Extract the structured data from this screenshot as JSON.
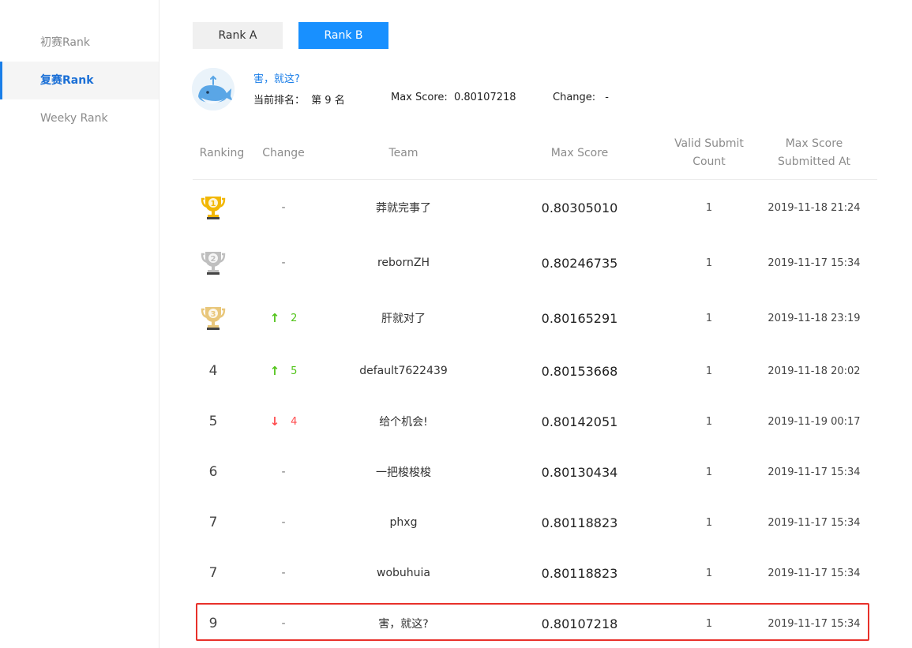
{
  "sidebar": {
    "items": [
      {
        "label": "初赛Rank",
        "active": false
      },
      {
        "label": "复赛Rank",
        "active": true
      },
      {
        "label": "Weeky Rank",
        "active": false
      }
    ]
  },
  "tabs": [
    {
      "label": "Rank A",
      "active": false
    },
    {
      "label": "Rank B",
      "active": true
    }
  ],
  "user": {
    "name": "害，就这?",
    "rank_label": "当前排名：",
    "rank_value": "第 9 名",
    "max_score_label": "Max Score:",
    "max_score_value": "0.80107218",
    "change_label": "Change:",
    "change_value": "-"
  },
  "table": {
    "headers": {
      "ranking": "Ranking",
      "change": "Change",
      "team": "Team",
      "max_score": "Max Score",
      "valid_submit_count": "Valid Submit Count",
      "submitted_at": "Max Score Submitted At"
    },
    "rows": [
      {
        "rank": "1",
        "trophy": "gold",
        "change": "-",
        "dir": "none",
        "team": "莽就完事了",
        "score": "0.80305010",
        "count": "1",
        "time": "2019-11-18 21:24"
      },
      {
        "rank": "2",
        "trophy": "silver",
        "change": "-",
        "dir": "none",
        "team": "rebornZH",
        "score": "0.80246735",
        "count": "1",
        "time": "2019-11-17 15:34"
      },
      {
        "rank": "3",
        "trophy": "bronze",
        "change": "2",
        "dir": "up",
        "team": "肝就对了",
        "score": "0.80165291",
        "count": "1",
        "time": "2019-11-18 23:19"
      },
      {
        "rank": "4",
        "trophy": "",
        "change": "5",
        "dir": "up",
        "team": "default7622439",
        "score": "0.80153668",
        "count": "1",
        "time": "2019-11-18 20:02"
      },
      {
        "rank": "5",
        "trophy": "",
        "change": "4",
        "dir": "down",
        "team": "给个机会!",
        "score": "0.80142051",
        "count": "1",
        "time": "2019-11-19 00:17"
      },
      {
        "rank": "6",
        "trophy": "",
        "change": "-",
        "dir": "none",
        "team": "一把梭梭梭",
        "score": "0.80130434",
        "count": "1",
        "time": "2019-11-17 15:34"
      },
      {
        "rank": "7",
        "trophy": "",
        "change": "-",
        "dir": "none",
        "team": "phxg",
        "score": "0.80118823",
        "count": "1",
        "time": "2019-11-17 15:34"
      },
      {
        "rank": "7",
        "trophy": "",
        "change": "-",
        "dir": "none",
        "team": "wobuhuia",
        "score": "0.80118823",
        "count": "1",
        "time": "2019-11-17 15:34"
      },
      {
        "rank": "9",
        "trophy": "",
        "change": "-",
        "dir": "none",
        "team": "害，就这?",
        "score": "0.80107218",
        "count": "1",
        "time": "2019-11-17 15:34"
      }
    ]
  },
  "colors": {
    "accent": "#1890ff",
    "up": "#52c41a",
    "down": "#ff4d4f",
    "highlight": "#e8312a",
    "gold": "#f2b705",
    "silver": "#bfbfbf",
    "bronze": "#e9c77b"
  },
  "icons": {
    "avatar": "whale-icon",
    "trophy": "trophy-icon",
    "up": "arrow-up-icon",
    "down": "arrow-down-icon"
  }
}
